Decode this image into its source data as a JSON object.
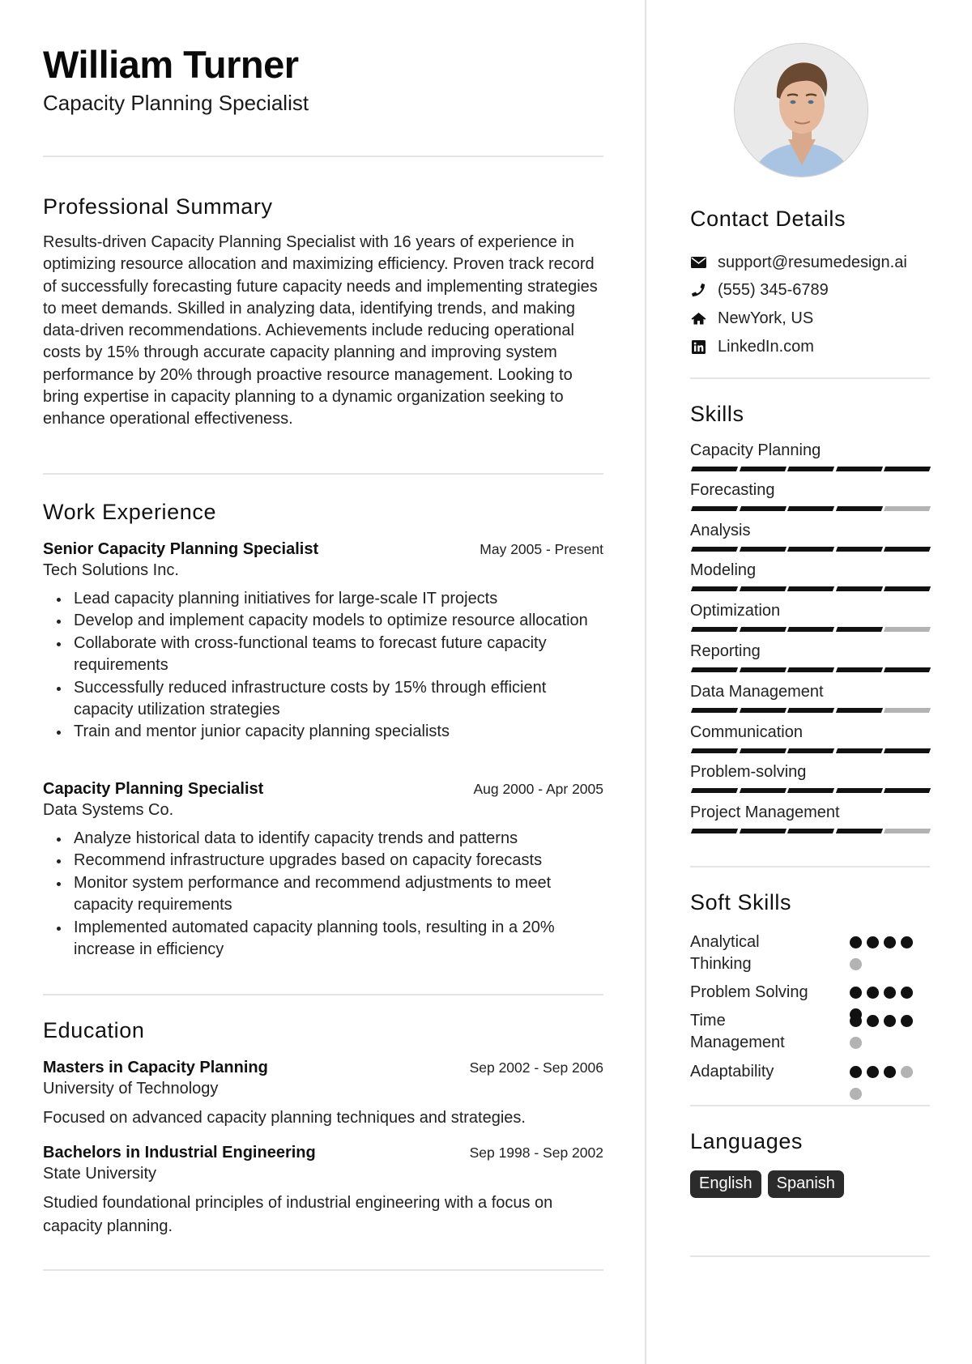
{
  "header": {
    "name": "William Turner",
    "title": "Capacity Planning Specialist"
  },
  "summary": {
    "heading": "Professional Summary",
    "text": "Results-driven Capacity Planning Specialist with 16 years of experience in optimizing resource allocation and maximizing efficiency. Proven track record of successfully forecasting future capacity needs and implementing strategies to meet demands. Skilled in analyzing data, identifying trends, and making data-driven recommendations. Achievements include reducing operational costs by 15% through accurate capacity planning and improving system performance by 20% through proactive resource management. Looking to bring expertise in capacity planning to a dynamic organization seeking to enhance operational effectiveness."
  },
  "experience": {
    "heading": "Work Experience",
    "jobs": [
      {
        "title": "Senior Capacity Planning Specialist",
        "company": "Tech Solutions Inc.",
        "dates": "May 2005 - Present",
        "bullets": [
          "Lead capacity planning initiatives for large-scale IT projects",
          "Develop and implement capacity models to optimize resource allocation",
          "Collaborate with cross-functional teams to forecast future capacity requirements",
          "Successfully reduced infrastructure costs by 15% through efficient capacity utilization strategies",
          "Train and mentor junior capacity planning specialists"
        ]
      },
      {
        "title": "Capacity Planning Specialist",
        "company": "Data Systems Co.",
        "dates": "Aug 2000 - Apr 2005",
        "bullets": [
          "Analyze historical data to identify capacity trends and patterns",
          "Recommend infrastructure upgrades based on capacity forecasts",
          "Monitor system performance and recommend adjustments to meet capacity requirements",
          "Implemented automated capacity planning tools, resulting in a 20% increase in efficiency"
        ]
      }
    ]
  },
  "education": {
    "heading": "Education",
    "items": [
      {
        "degree": "Masters in Capacity Planning",
        "school": "University of Technology",
        "dates": "Sep 2002 - Sep 2006",
        "description": "Focused on advanced capacity planning techniques and strategies."
      },
      {
        "degree": "Bachelors in Industrial Engineering",
        "school": "State University",
        "dates": "Sep 1998 - Sep 2002",
        "description": "Studied foundational principles of industrial engineering with a focus on capacity planning."
      }
    ]
  },
  "contact": {
    "heading": "Contact Details",
    "items": [
      {
        "icon": "envelope-icon",
        "text": "support@resumedesign.ai"
      },
      {
        "icon": "phone-icon",
        "text": "(555) 345-6789"
      },
      {
        "icon": "home-icon",
        "text": "NewYork, US"
      },
      {
        "icon": "linkedin-icon",
        "text": "LinkedIn.com"
      }
    ]
  },
  "skills": {
    "heading": "Skills",
    "max": 5,
    "items": [
      {
        "name": "Capacity Planning",
        "level": 5
      },
      {
        "name": "Forecasting",
        "level": 4
      },
      {
        "name": "Analysis",
        "level": 5
      },
      {
        "name": "Modeling",
        "level": 5
      },
      {
        "name": "Optimization",
        "level": 4
      },
      {
        "name": "Reporting",
        "level": 5
      },
      {
        "name": "Data Management",
        "level": 4
      },
      {
        "name": "Communication",
        "level": 5
      },
      {
        "name": "Problem-solving",
        "level": 5
      },
      {
        "name": "Project Management",
        "level": 4
      }
    ]
  },
  "soft_skills": {
    "heading": "Soft Skills",
    "max": 5,
    "items": [
      {
        "name": "Analytical Thinking",
        "level": 4
      },
      {
        "name": "Problem Solving",
        "level": 5
      },
      {
        "name": "Time Management",
        "level": 4
      },
      {
        "name": "Adaptability",
        "level": 3
      }
    ]
  },
  "languages": {
    "heading": "Languages",
    "items": [
      "English",
      "Spanish"
    ]
  },
  "colors": {
    "text": "#111111",
    "bar_filled": "#111111",
    "bar_empty": "#b3b3b3",
    "divider": "#e4e4e4",
    "language_badge": "#2b2b2b"
  }
}
